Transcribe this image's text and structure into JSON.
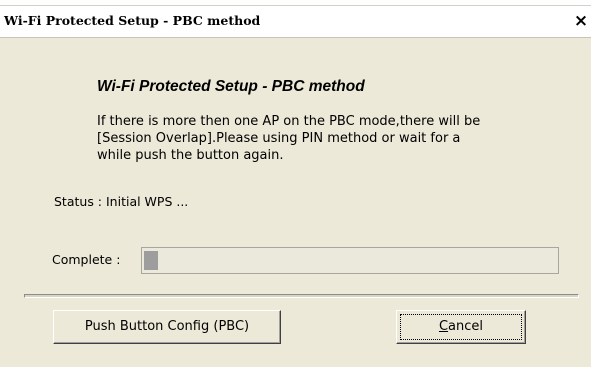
{
  "window": {
    "title": "Wi-Fi Protected Setup - PBC method",
    "close_glyph": "×"
  },
  "content": {
    "heading": "Wi-Fi Protected Setup - PBC method",
    "message_lines": [
      "If there is more then one AP on the PBC mode,there will be",
      "[Session Overlap].Please using PIN method or wait for a",
      "while push the button again."
    ],
    "status_text": "Status : Initial WPS ...",
    "complete_label": "Complete :",
    "progress_fraction": 0.03
  },
  "buttons": {
    "pbc_label": "Push Button Config (PBC)",
    "cancel_mnemonic": "C",
    "cancel_rest": "ancel"
  },
  "icons": {
    "close": "close-icon"
  }
}
